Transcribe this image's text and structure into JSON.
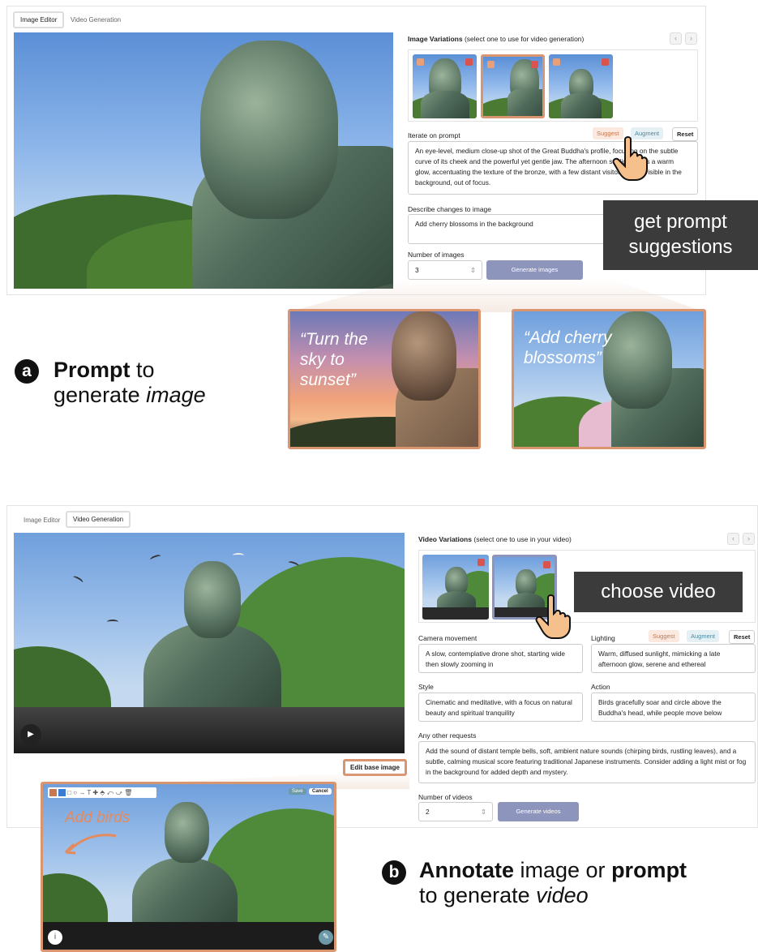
{
  "top": {
    "tabs": [
      "Image Editor",
      "Video Generation"
    ],
    "variations_title": "Image Variations",
    "variations_hint": "(select one to use for video generation)",
    "iterate_label": "Iterate on prompt",
    "suggest": "Suggest",
    "augment": "Augment",
    "reset": "Reset",
    "prompt_text": "An eye-level, medium close-up shot of the Great Buddha's profile, focusing on the subtle curve of its cheek and the powerful yet gentle jaw. The afternoon sunlight casts a warm glow, accentuating the texture of the bronze, with a few distant visitors faintly visible in the background, out of focus.",
    "describe_label": "Describe changes to image",
    "describe_value": "Add cherry blossoms in the background",
    "num_label": "Number of images",
    "num_value": "3",
    "generate": "Generate images",
    "callout": "get prompt suggestions",
    "quote1": "“Turn the sky to sunset”",
    "quote2": "“Add cherry blossoms”",
    "caption_a_badge": "a",
    "caption_a_bold": "Prompt",
    "caption_a_rest1": " to",
    "caption_a_line2a": "generate ",
    "caption_a_line2b": "image"
  },
  "bottom": {
    "tabs": [
      "Image Editor",
      "Video Generation"
    ],
    "variations_title": "Video Variations",
    "variations_hint": "(select one to use in your video)",
    "callout": "choose video",
    "camera_label": "Camera movement",
    "camera_text": "A slow, contemplative drone shot, starting wide then slowly zooming in",
    "lighting_label": "Lighting",
    "lighting_text": "Warm, diffused sunlight, mimicking a late afternoon glow, serene and ethereal",
    "style_label": "Style",
    "style_text": "Cinematic and meditative, with a focus on natural beauty and spiritual tranquility",
    "action_label": "Action",
    "action_text": "Birds gracefully soar and circle above the Buddha's head, while people move below",
    "other_label": "Any other requests",
    "other_text": "Add the sound of distant temple bells, soft, ambient nature sounds (chirping birds, rustling leaves), and a subtle, calming musical score featuring traditional Japanese instruments. Consider adding a light mist or fog in the background for added depth and mystery.",
    "num_label": "Number of videos",
    "num_value": "2",
    "generate": "Generate videos",
    "suggest": "Suggest",
    "augment": "Augment",
    "reset": "Reset",
    "edit_base": "Edit base image",
    "save": "Save",
    "cancel": "Cancel",
    "annot_text": "Add birds",
    "caption_b_badge": "b",
    "caption_b_bold1": "Annotate",
    "caption_b_mid": " image or ",
    "caption_b_bold2": "prompt",
    "caption_b_line2a": "to generate ",
    "caption_b_line2b": "video"
  },
  "colors": {
    "accent": "#d99470",
    "button": "#8e95bd",
    "callout_bg": "#3b3b3b"
  }
}
